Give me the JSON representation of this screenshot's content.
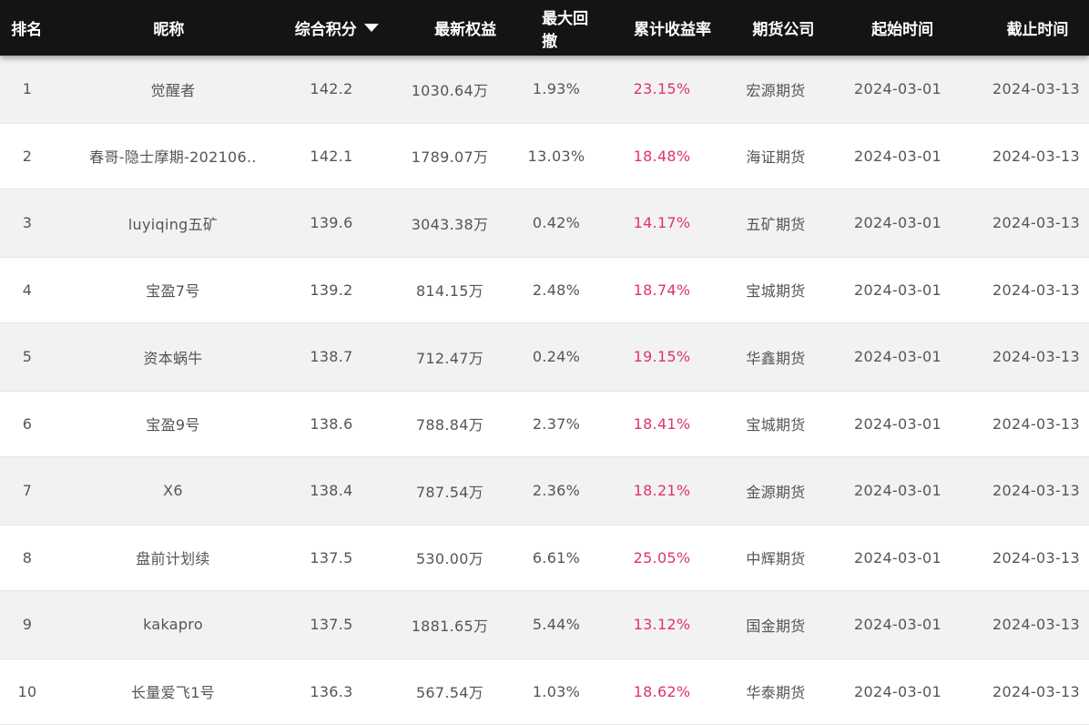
{
  "headers": {
    "rank": "排名",
    "name": "昵称",
    "score": "综合积分",
    "equity": "最新权益",
    "drawdown": "最大回撤",
    "return": "累计收益率",
    "company": "期货公司",
    "start": "起始时间",
    "end": "截止时间"
  },
  "rows": [
    {
      "rank": "1",
      "name": "觉醒者",
      "score": "142.2",
      "equity": "1030.64万",
      "drawdown": "1.93%",
      "return": "23.15%",
      "company": "宏源期货",
      "start": "2024-03-01",
      "end": "2024-03-13"
    },
    {
      "rank": "2",
      "name": "春哥-隐士摩期-202106..",
      "score": "142.1",
      "equity": "1789.07万",
      "drawdown": "13.03%",
      "return": "18.48%",
      "company": "海证期货",
      "start": "2024-03-01",
      "end": "2024-03-13"
    },
    {
      "rank": "3",
      "name": "luyiqing五矿",
      "score": "139.6",
      "equity": "3043.38万",
      "drawdown": "0.42%",
      "return": "14.17%",
      "company": "五矿期货",
      "start": "2024-03-01",
      "end": "2024-03-13"
    },
    {
      "rank": "4",
      "name": "宝盈7号",
      "score": "139.2",
      "equity": "814.15万",
      "drawdown": "2.48%",
      "return": "18.74%",
      "company": "宝城期货",
      "start": "2024-03-01",
      "end": "2024-03-13"
    },
    {
      "rank": "5",
      "name": "资本蜗牛",
      "score": "138.7",
      "equity": "712.47万",
      "drawdown": "0.24%",
      "return": "19.15%",
      "company": "华鑫期货",
      "start": "2024-03-01",
      "end": "2024-03-13"
    },
    {
      "rank": "6",
      "name": "宝盈9号",
      "score": "138.6",
      "equity": "788.84万",
      "drawdown": "2.37%",
      "return": "18.41%",
      "company": "宝城期货",
      "start": "2024-03-01",
      "end": "2024-03-13"
    },
    {
      "rank": "7",
      "name": "X6",
      "score": "138.4",
      "equity": "787.54万",
      "drawdown": "2.36%",
      "return": "18.21%",
      "company": "金源期货",
      "start": "2024-03-01",
      "end": "2024-03-13"
    },
    {
      "rank": "8",
      "name": "盘前计划续",
      "score": "137.5",
      "equity": "530.00万",
      "drawdown": "6.61%",
      "return": "25.05%",
      "company": "中辉期货",
      "start": "2024-03-01",
      "end": "2024-03-13"
    },
    {
      "rank": "9",
      "name": "kakapro",
      "score": "137.5",
      "equity": "1881.65万",
      "drawdown": "5.44%",
      "return": "13.12%",
      "company": "国金期货",
      "start": "2024-03-01",
      "end": "2024-03-13"
    },
    {
      "rank": "10",
      "name": "长量爱飞1号",
      "score": "136.3",
      "equity": "567.54万",
      "drawdown": "1.03%",
      "return": "18.62%",
      "company": "华泰期货",
      "start": "2024-03-01",
      "end": "2024-03-13"
    }
  ],
  "colors": {
    "header_bg": "#141414",
    "odd_row_bg": "#f2f2f2",
    "return_color": "#e0326e",
    "text_color": "#555555"
  },
  "icons": {
    "sort": "sort-descending-icon"
  }
}
